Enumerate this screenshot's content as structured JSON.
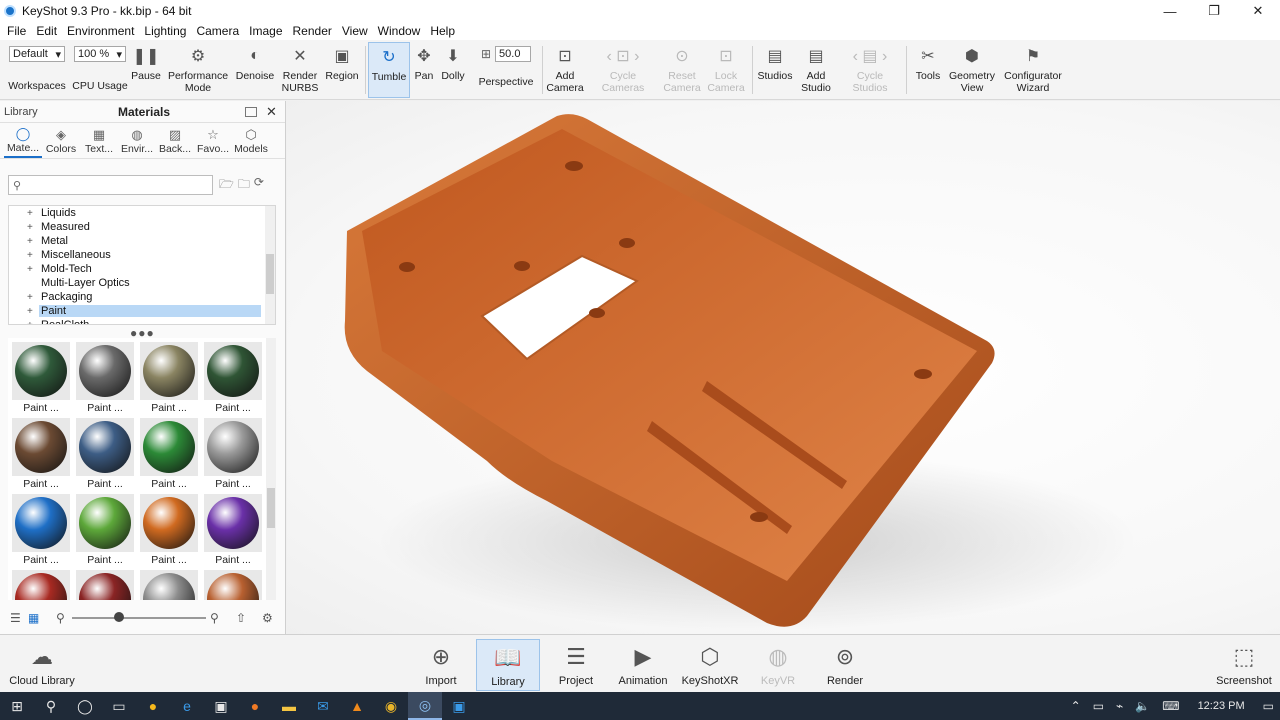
{
  "window": {
    "title": "KeyShot 9.3 Pro  - kk.bip  - 64 bit",
    "controls": [
      "—",
      "❐",
      "✕"
    ]
  },
  "menu": [
    "File",
    "Edit",
    "Environment",
    "Lighting",
    "Camera",
    "Image",
    "Render",
    "View",
    "Window",
    "Help"
  ],
  "toolbar": {
    "workspaces_value": "Default",
    "workspaces_label": "Workspaces",
    "cpu_value": "100 %",
    "cpu_label": "CPU Usage",
    "pause": "Pause",
    "performance_mode": "Performance Mode",
    "denoise": "Denoise",
    "render_nurbs": "Render NURBS",
    "region": "Region",
    "tumble": "Tumble",
    "pan": "Pan",
    "dolly": "Dolly",
    "fov_value": "50.0",
    "perspective": "Perspective",
    "add_camera": "Add Camera",
    "cycle_cameras": "Cycle Cameras",
    "reset_camera": "Reset Camera",
    "lock_camera": "Lock Camera",
    "studios": "Studios",
    "add_studio": "Add Studio",
    "cycle_studios": "Cycle Studios",
    "tools": "Tools",
    "geometry_view": "Geometry View",
    "configurator_wizard": "Configurator Wizard"
  },
  "library": {
    "header_left": "Library",
    "header_title": "Materials",
    "tabs": [
      {
        "label": "Mate..."
      },
      {
        "label": "Colors"
      },
      {
        "label": "Text..."
      },
      {
        "label": "Envir..."
      },
      {
        "label": "Back..."
      },
      {
        "label": "Favo..."
      },
      {
        "label": "Models"
      }
    ],
    "search_placeholder": "",
    "tree": [
      {
        "label": "Liquids",
        "expandable": true
      },
      {
        "label": "Measured",
        "expandable": true
      },
      {
        "label": "Metal",
        "expandable": true
      },
      {
        "label": "Miscellaneous",
        "expandable": true
      },
      {
        "label": "Mold-Tech",
        "expandable": true
      },
      {
        "label": "Multi-Layer Optics",
        "expandable": false
      },
      {
        "label": "Packaging",
        "expandable": true
      },
      {
        "label": "Paint",
        "expandable": true,
        "selected": true
      },
      {
        "label": "RealCloth",
        "expandable": true
      }
    ],
    "materials": [
      {
        "label": "Paint ...",
        "color": "#2f5a3a"
      },
      {
        "label": "Paint ...",
        "color": "#6a6a6a"
      },
      {
        "label": "Paint ...",
        "color": "#8a8462"
      },
      {
        "label": "Paint ...",
        "color": "#2f5535"
      },
      {
        "label": "Paint ...",
        "color": "#6b4a33"
      },
      {
        "label": "Paint ...",
        "color": "#3d5d85"
      },
      {
        "label": "Paint ...",
        "color": "#2c8a37"
      },
      {
        "label": "Paint ...",
        "color": "#9a9a9a"
      },
      {
        "label": "Paint ...",
        "color": "#1f6fc6"
      },
      {
        "label": "Paint ...",
        "color": "#5da83a"
      },
      {
        "label": "Paint ...",
        "color": "#d06a20"
      },
      {
        "label": "Paint ...",
        "color": "#6a30a8"
      },
      {
        "label": "",
        "color": "#a82a22"
      },
      {
        "label": "",
        "color": "#8a2424"
      },
      {
        "label": "",
        "color": "#8c8c8c"
      },
      {
        "label": "",
        "color": "#b86030"
      }
    ]
  },
  "ribbon": {
    "cloud_library": "Cloud Library",
    "import": "Import",
    "library": "Library",
    "project": "Project",
    "animation": "Animation",
    "keyshotxr": "KeyShotXR",
    "keyvr": "KeyVR",
    "render": "Render",
    "screenshot": "Screenshot"
  },
  "taskbar": {
    "clock": "12:23 PM"
  },
  "colors": {
    "model_orange": "#c8622a",
    "accent_blue": "#1b6fc9"
  }
}
